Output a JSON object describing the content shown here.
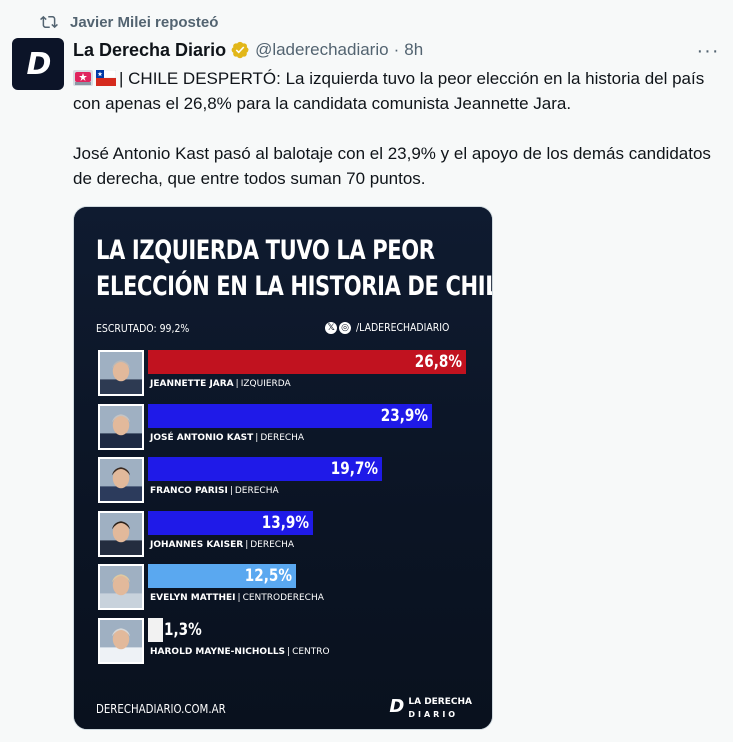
{
  "repost": {
    "label": "Javier Milei reposteó"
  },
  "author": {
    "name": "La Derecha Diario",
    "handle": "@laderechadiario",
    "time": "8h",
    "avatar_glyph": "D"
  },
  "post": {
    "line1": "| CHILE DESPERTÓ: La izquierda tuvo la peor elección en la historia del país con apenas el 26,8% para la candidata comunista Jeannette Jara.",
    "line2": "José Antonio Kast pasó al balotaje con el 23,9% y el apoyo de los demás candidatos de derecha, que entre todos suman 70 puntos."
  },
  "infographic": {
    "title_line1": "LA IZQUIERDA TUVO LA PEOR",
    "title_line2": "ELECCIÓN EN LA HISTORIA DE CHILE",
    "scrutiny": "ESCRUTADO: 99,2%",
    "social_handle": "/LADERECHADIARIO",
    "footer_url": "DERECHADIARIO.COM.AR",
    "footer_logo_1": "LA DERECHA",
    "footer_logo_2": "DIARIO",
    "candidates": [
      {
        "name": "JEANNETTE JARA",
        "party": "IZQUIERDA",
        "value_label": "26,8%",
        "value": 26.8,
        "color": "#c1121f",
        "hair": "#b8b8b8",
        "shirt": "#2d3a52"
      },
      {
        "name": "JOSÉ ANTONIO KAST",
        "party": "DERECHA",
        "value_label": "23,9%",
        "value": 23.9,
        "color": "#1f1ae8",
        "hair": "#c4c4c4",
        "shirt": "#1e2a44"
      },
      {
        "name": "FRANCO PARISI",
        "party": "DERECHA",
        "value_label": "19,7%",
        "value": 19.7,
        "color": "#1f1ae8",
        "hair": "#3a2a20",
        "shirt": "#2c3b5c"
      },
      {
        "name": "JOHANNES KAISER",
        "party": "DERECHA",
        "value_label": "13,9%",
        "value": 13.9,
        "color": "#1f1ae8",
        "hair": "#2b2018",
        "shirt": "#242d3f"
      },
      {
        "name": "EVELYN MATTHEI",
        "party": "CENTRODERECHA",
        "value_label": "12,5%",
        "value": 12.5,
        "color": "#5aa8f0",
        "hair": "#e0c9a0",
        "shirt": "#c8d2dc"
      },
      {
        "name": "HAROLD MAYNE-NICHOLLS",
        "party": "CENTRO",
        "value_label": "1,3%",
        "value": 1.3,
        "color": "#f2f2f2",
        "hair": "#d8d8d8",
        "shirt": "#eef2f6"
      }
    ]
  }
}
